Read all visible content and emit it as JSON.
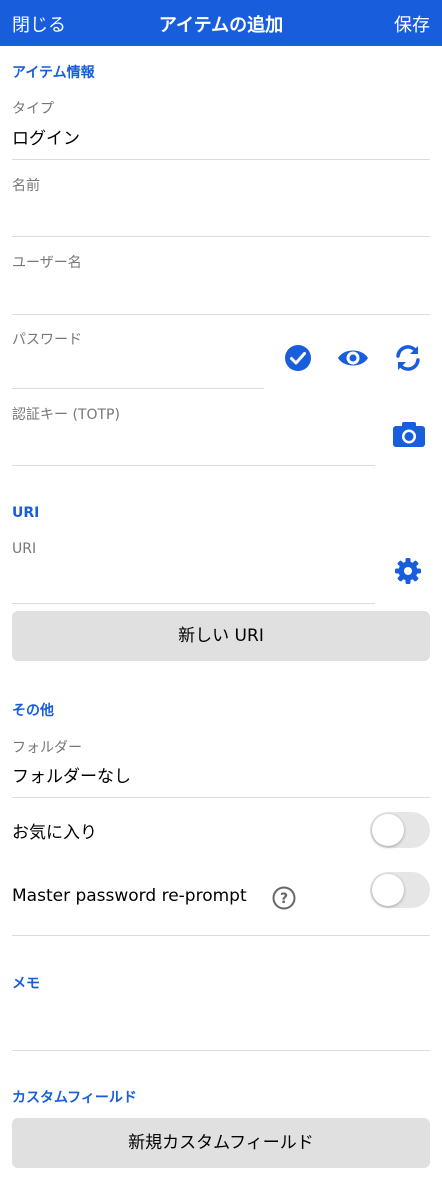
{
  "header": {
    "close_label": "閉じる",
    "title": "アイテムの追加",
    "save_label": "保存",
    "background_color": "#175ddc"
  },
  "item_info": {
    "section_title": "アイテム情報",
    "type_label": "タイプ",
    "type_value": "ログイン",
    "name_label": "名前",
    "name_value": "",
    "username_label": "ユーザー名",
    "username_value": "",
    "password_label": "パスワード",
    "password_value": "",
    "password_icons": [
      "check-circle-icon",
      "eye-icon",
      "refresh-icon"
    ],
    "totp_label": "認証キー (TOTP)",
    "totp_value": "",
    "totp_icon": "camera-icon"
  },
  "uri": {
    "section_title": "URI",
    "uri_label": "URI",
    "uri_value": "",
    "uri_icon": "gear-icon",
    "new_uri_button": "新しい URI"
  },
  "other": {
    "section_title": "その他",
    "folder_label": "フォルダー",
    "folder_value": "フォルダーなし",
    "favorite_label": "お気に入り",
    "favorite_on": false,
    "reprompt_label": "Master password re-prompt",
    "reprompt_on": false,
    "help_icon": "question-circle-icon"
  },
  "notes": {
    "section_title": "メモ",
    "value": ""
  },
  "custom_fields": {
    "section_title": "カスタムフィールド",
    "new_field_button": "新規カスタムフィールド"
  },
  "accent_color": "#175ddc"
}
